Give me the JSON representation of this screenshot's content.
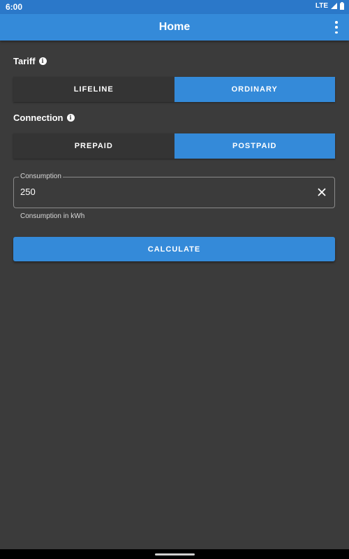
{
  "status_bar": {
    "time": "6:00",
    "network": "LTE"
  },
  "app_bar": {
    "title": "Home",
    "menu_icon": "more-vert-icon"
  },
  "tariff": {
    "label": "Tariff",
    "info_icon": "info-icon",
    "options": [
      "LIFELINE",
      "ORDINARY"
    ],
    "selected": "ORDINARY"
  },
  "connection": {
    "label": "Connection",
    "info_icon": "info-icon",
    "options": [
      "PREPAID",
      "POSTPAID"
    ],
    "selected": "POSTPAID"
  },
  "consumption": {
    "label": "Consumption",
    "value": "250",
    "helper": "Consumption in kWh",
    "clear_icon": "close-icon"
  },
  "calculate_button": {
    "label": "CALCULATE"
  },
  "colors": {
    "accent": "#348ad9",
    "status_bar": "#2b78c9",
    "background": "#3b3b3b",
    "unselected": "#343434"
  }
}
